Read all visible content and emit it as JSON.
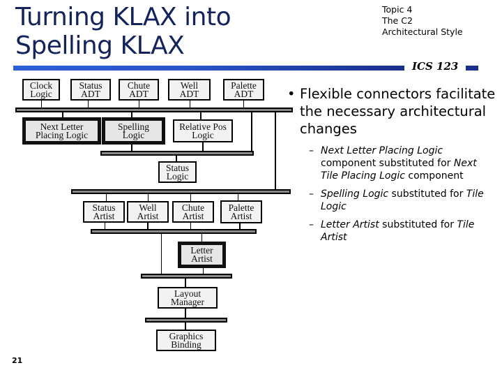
{
  "slide": {
    "title_lines": [
      "Turning KLAX into",
      "Spelling KLAX"
    ],
    "topic_lines": [
      "Topic 4",
      "The C2",
      "Architectural Style"
    ],
    "course": "ICS 123",
    "page_number": "21",
    "colors": {
      "title": "#14235c",
      "rule_start": "#2f5fd8",
      "rule_end": "#1a2f8c"
    }
  },
  "diagram": {
    "components": {
      "clock_logic": [
        "Clock",
        "Logic"
      ],
      "status_adt": [
        "Status",
        "ADT"
      ],
      "chute_adt": [
        "Chute",
        "ADT"
      ],
      "well_adt": [
        "Well",
        "ADT"
      ],
      "palette_adt": [
        "Palette",
        "ADT"
      ],
      "next_letter_placing_logic": [
        "Next Letter",
        "Placing Logic"
      ],
      "spelling_logic": [
        "Spelling",
        "Logic"
      ],
      "relative_pos_logic": [
        "Relative Pos",
        "Logic"
      ],
      "status_logic": [
        "Status",
        "Logic"
      ],
      "status_artist": [
        "Status",
        "Artist"
      ],
      "well_artist": [
        "Well",
        "Artist"
      ],
      "chute_artist": [
        "Chute",
        "Artist"
      ],
      "palette_artist": [
        "Palette",
        "Artist"
      ],
      "letter_artist": [
        "Letter",
        "Artist"
      ],
      "layout_manager": [
        "Layout",
        "Manager"
      ],
      "graphics_binding": [
        "Graphics",
        "Binding"
      ]
    },
    "substituted_components": [
      "Next Letter Placing Logic",
      "Spelling Logic",
      "Letter Artist"
    ]
  },
  "bullets": {
    "main": {
      "marker": "•",
      "text": "Flexible connectors facilitate the necessary architectural changes"
    },
    "subs": [
      {
        "marker": "–",
        "italic1": "Next Letter Placing Logic",
        "plain1": " component substituted for ",
        "italic2": "Next Tile Placing Logic",
        "plain2": " component"
      },
      {
        "marker": "–",
        "italic1": "Spelling Logic",
        "plain1": " substituted for ",
        "italic2": "Tile Logic",
        "plain2": ""
      },
      {
        "marker": "–",
        "italic1": "Letter Artist",
        "plain1": " substituted for ",
        "italic2": "Tile Artist",
        "plain2": ""
      }
    ]
  }
}
